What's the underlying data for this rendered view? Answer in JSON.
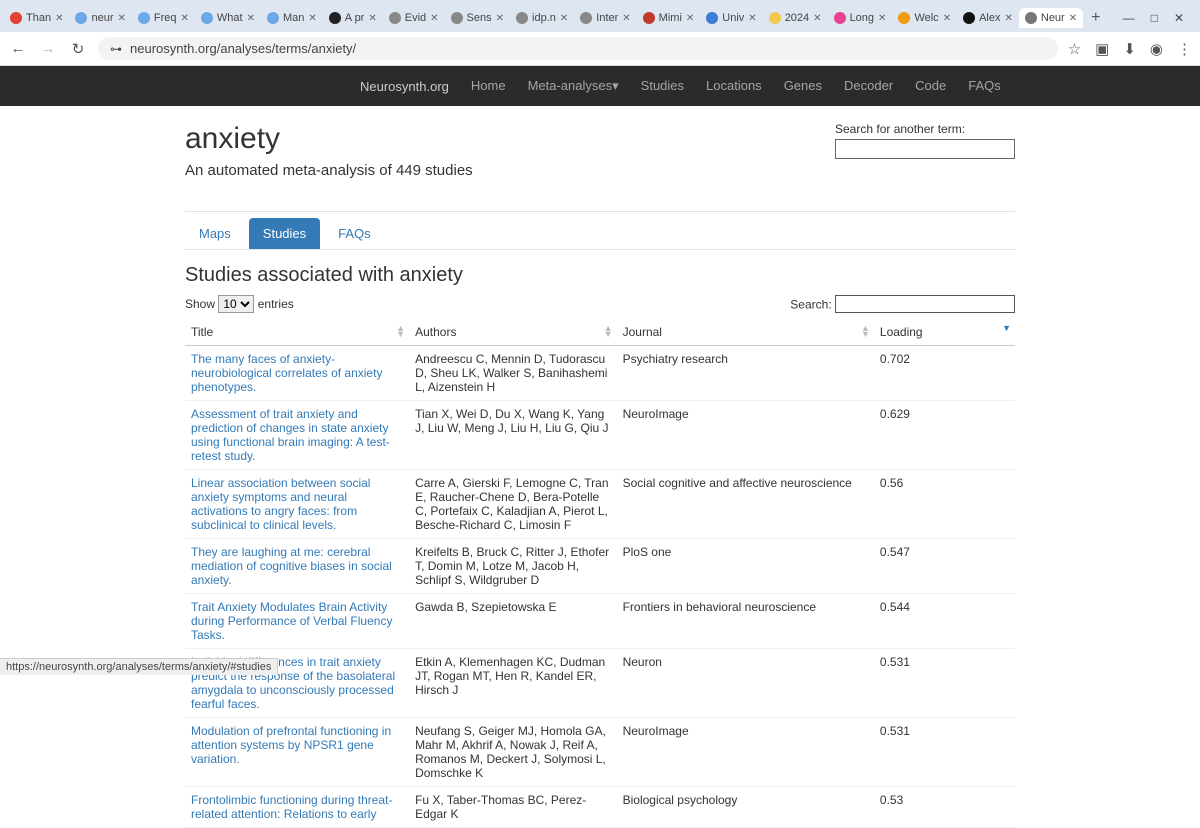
{
  "browser": {
    "tabs": [
      {
        "label": "Than",
        "fav": "#e34133"
      },
      {
        "label": "neur",
        "fav": "#6aa8e8"
      },
      {
        "label": "Freq",
        "fav": "#6aa8e8"
      },
      {
        "label": "What",
        "fav": "#6aa8e8"
      },
      {
        "label": "Man",
        "fav": "#6aa8e8"
      },
      {
        "label": "A pr",
        "fav": "#222"
      },
      {
        "label": "Evid",
        "fav": "#888"
      },
      {
        "label": "Sens",
        "fav": "#888"
      },
      {
        "label": "idp.n",
        "fav": "#888"
      },
      {
        "label": "Inter",
        "fav": "#888"
      },
      {
        "label": "Mimi",
        "fav": "#c0392b"
      },
      {
        "label": "Univ",
        "fav": "#3b7dd8"
      },
      {
        "label": "2024",
        "fav": "#f2c94c"
      },
      {
        "label": "Long",
        "fav": "#e84393"
      },
      {
        "label": "Welc",
        "fav": "#f39c12"
      },
      {
        "label": "Alex",
        "fav": "#111"
      },
      {
        "label": "Neur",
        "fav": "#777",
        "active": true
      }
    ],
    "url": "neurosynth.org/analyses/terms/anxiety/",
    "winctrls": {
      "min": "—",
      "max": "□",
      "close": "✕"
    }
  },
  "sitenav": {
    "brand": "Neurosynth.org",
    "items": [
      "Home",
      "Meta-analyses▾",
      "Studies",
      "Locations",
      "Genes",
      "Decoder",
      "Code",
      "FAQs"
    ]
  },
  "page": {
    "term": "anxiety",
    "subtitle": "An automated meta-analysis of 449 studies",
    "search_label": "Search for another term:",
    "subtabs": {
      "items": [
        "Maps",
        "Studies",
        "FAQs"
      ],
      "active": 1
    },
    "section_title": "Studies associated with anxiety",
    "show_label_pre": "Show",
    "show_value": "10",
    "show_label_post": "entries",
    "search_table_label": "Search:",
    "columns": [
      "Title",
      "Authors",
      "Journal",
      "Loading"
    ],
    "sorted_col": 3,
    "rows": [
      {
        "title": "The many faces of anxiety-neurobiological correlates of anxiety phenotypes.",
        "authors": "Andreescu C, Mennin D, Tudorascu D, Sheu LK, Walker S, Banihashemi L, Aizenstein H",
        "journal": "Psychiatry research",
        "loading": "0.702"
      },
      {
        "title": "Assessment of trait anxiety and prediction of changes in state anxiety using functional brain imaging: A test-retest study.",
        "authors": "Tian X, Wei D, Du X, Wang K, Yang J, Liu W, Meng J, Liu H, Liu G, Qiu J",
        "journal": "NeuroImage",
        "loading": "0.629"
      },
      {
        "title": "Linear association between social anxiety symptoms and neural activations to angry faces: from subclinical to clinical levels.",
        "authors": "Carre A, Gierski F, Lemogne C, Tran E, Raucher-Chene D, Bera-Potelle C, Portefaix C, Kaladjian A, Pierot L, Besche-Richard C, Limosin F",
        "journal": "Social cognitive and affective neuroscience",
        "loading": "0.56"
      },
      {
        "title": "They are laughing at me: cerebral mediation of cognitive biases in social anxiety.",
        "authors": "Kreifelts B, Bruck C, Ritter J, Ethofer T, Domin M, Lotze M, Jacob H, Schlipf S, Wildgruber D",
        "journal": "PloS one",
        "loading": "0.547"
      },
      {
        "title": "Trait Anxiety Modulates Brain Activity during Performance of Verbal Fluency Tasks.",
        "authors": "Gawda B, Szepietowska E",
        "journal": "Frontiers in behavioral neuroscience",
        "loading": "0.544"
      },
      {
        "title": "Individual differences in trait anxiety predict the response of the basolateral amygdala to unconsciously processed fearful faces.",
        "authors": "Etkin A, Klemenhagen KC, Dudman JT, Rogan MT, Hen R, Kandel ER, Hirsch J",
        "journal": "Neuron",
        "loading": "0.531"
      },
      {
        "title": "Modulation of prefrontal functioning in attention systems by NPSR1 gene variation.",
        "authors": "Neufang S, Geiger MJ, Homola GA, Mahr M, Akhrif A, Nowak J, Reif A, Romanos M, Deckert J, Solymosi L, Domschke K",
        "journal": "NeuroImage",
        "loading": "0.531"
      },
      {
        "title": "Frontolimbic functioning during threat-related attention: Relations to early",
        "authors": "Fu X, Taber-Thomas BC, Perez-Edgar K",
        "journal": "Biological psychology",
        "loading": "0.53"
      }
    ]
  },
  "status_url": "https://neurosynth.org/analyses/terms/anxiety/#studies"
}
